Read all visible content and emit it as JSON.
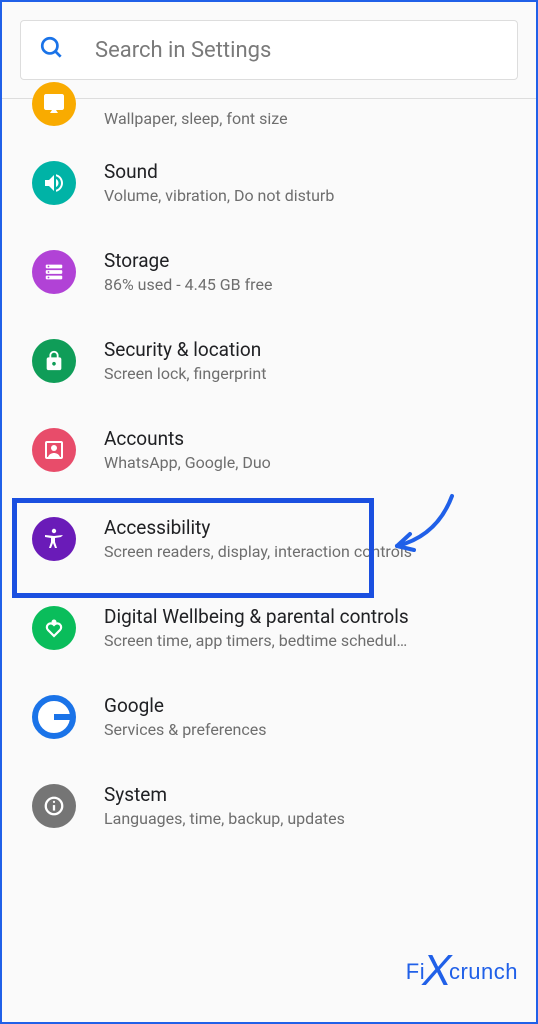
{
  "search": {
    "placeholder": "Search in Settings"
  },
  "items": [
    {
      "title": "",
      "subtitle": "Wallpaper, sleep, font size",
      "color": "#f9ab00"
    },
    {
      "title": "Sound",
      "subtitle": "Volume, vibration, Do not disturb",
      "color": "#00b3a6"
    },
    {
      "title": "Storage",
      "subtitle": "86% used - 4.45 GB free",
      "color": "#b142d6"
    },
    {
      "title": "Security & location",
      "subtitle": "Screen lock, fingerprint",
      "color": "#0f9d58"
    },
    {
      "title": "Accounts",
      "subtitle": "WhatsApp, Google, Duo",
      "color": "#e84c6a"
    },
    {
      "title": "Accessibility",
      "subtitle": "Screen readers, display, interaction controls",
      "color": "#6a1bb8"
    },
    {
      "title": "Digital Wellbeing & parental controls",
      "subtitle": "Screen time, app timers, bedtime schedul…",
      "color": "#0abd5b"
    },
    {
      "title": "Google",
      "subtitle": "Services & preferences",
      "color": "#ffffff"
    },
    {
      "title": "System",
      "subtitle": "Languages, time, backup, updates",
      "color": "#757575"
    }
  ],
  "watermark": {
    "left": "Fi",
    "right": "crunch"
  }
}
